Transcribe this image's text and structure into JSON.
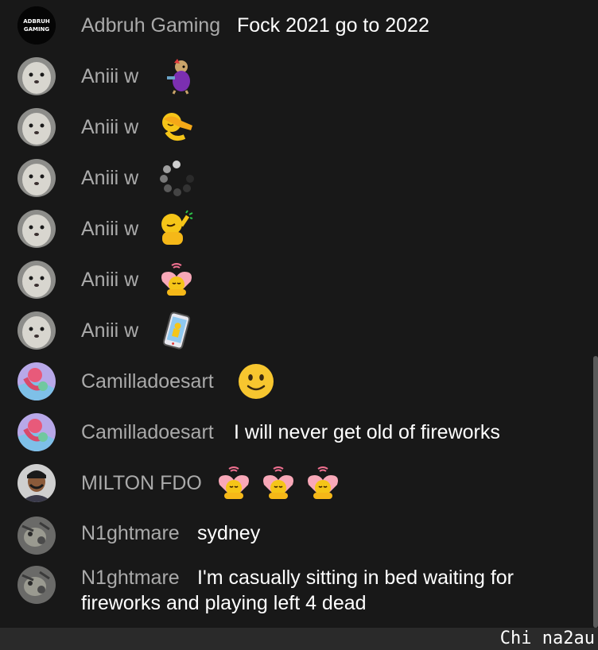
{
  "messages": [
    {
      "author": "Adbruh Gaming",
      "text": "Fock 2021 go to 2022",
      "avatar_text": "ADBRUH GAMING"
    },
    {
      "author": "Aniii w",
      "emoji": "monkey-icon"
    },
    {
      "author": "Aniii w",
      "emoji": "dab-icon"
    },
    {
      "author": "Aniii w",
      "emoji": "loading-icon"
    },
    {
      "author": "Aniii w",
      "emoji": "smile-point-icon"
    },
    {
      "author": "Aniii w",
      "emoji": "heart-hug-icon"
    },
    {
      "author": "Aniii w",
      "emoji": "phone-icon"
    },
    {
      "author": "Camilladoesart",
      "emoji": "slightly-smiling-face-icon"
    },
    {
      "author": "Camilladoesart",
      "text": "I will never get old of fireworks"
    },
    {
      "author": "MILTON FDO",
      "emoji": "heart-hug-icon",
      "emoji_count": 3
    },
    {
      "author": "N1ghtmare",
      "text": "sydney"
    },
    {
      "author": "N1ghtmare",
      "text": "I'm casually sitting in bed waiting for fireworks and playing left 4 dead"
    }
  ],
  "watermark": "Chi na2au"
}
